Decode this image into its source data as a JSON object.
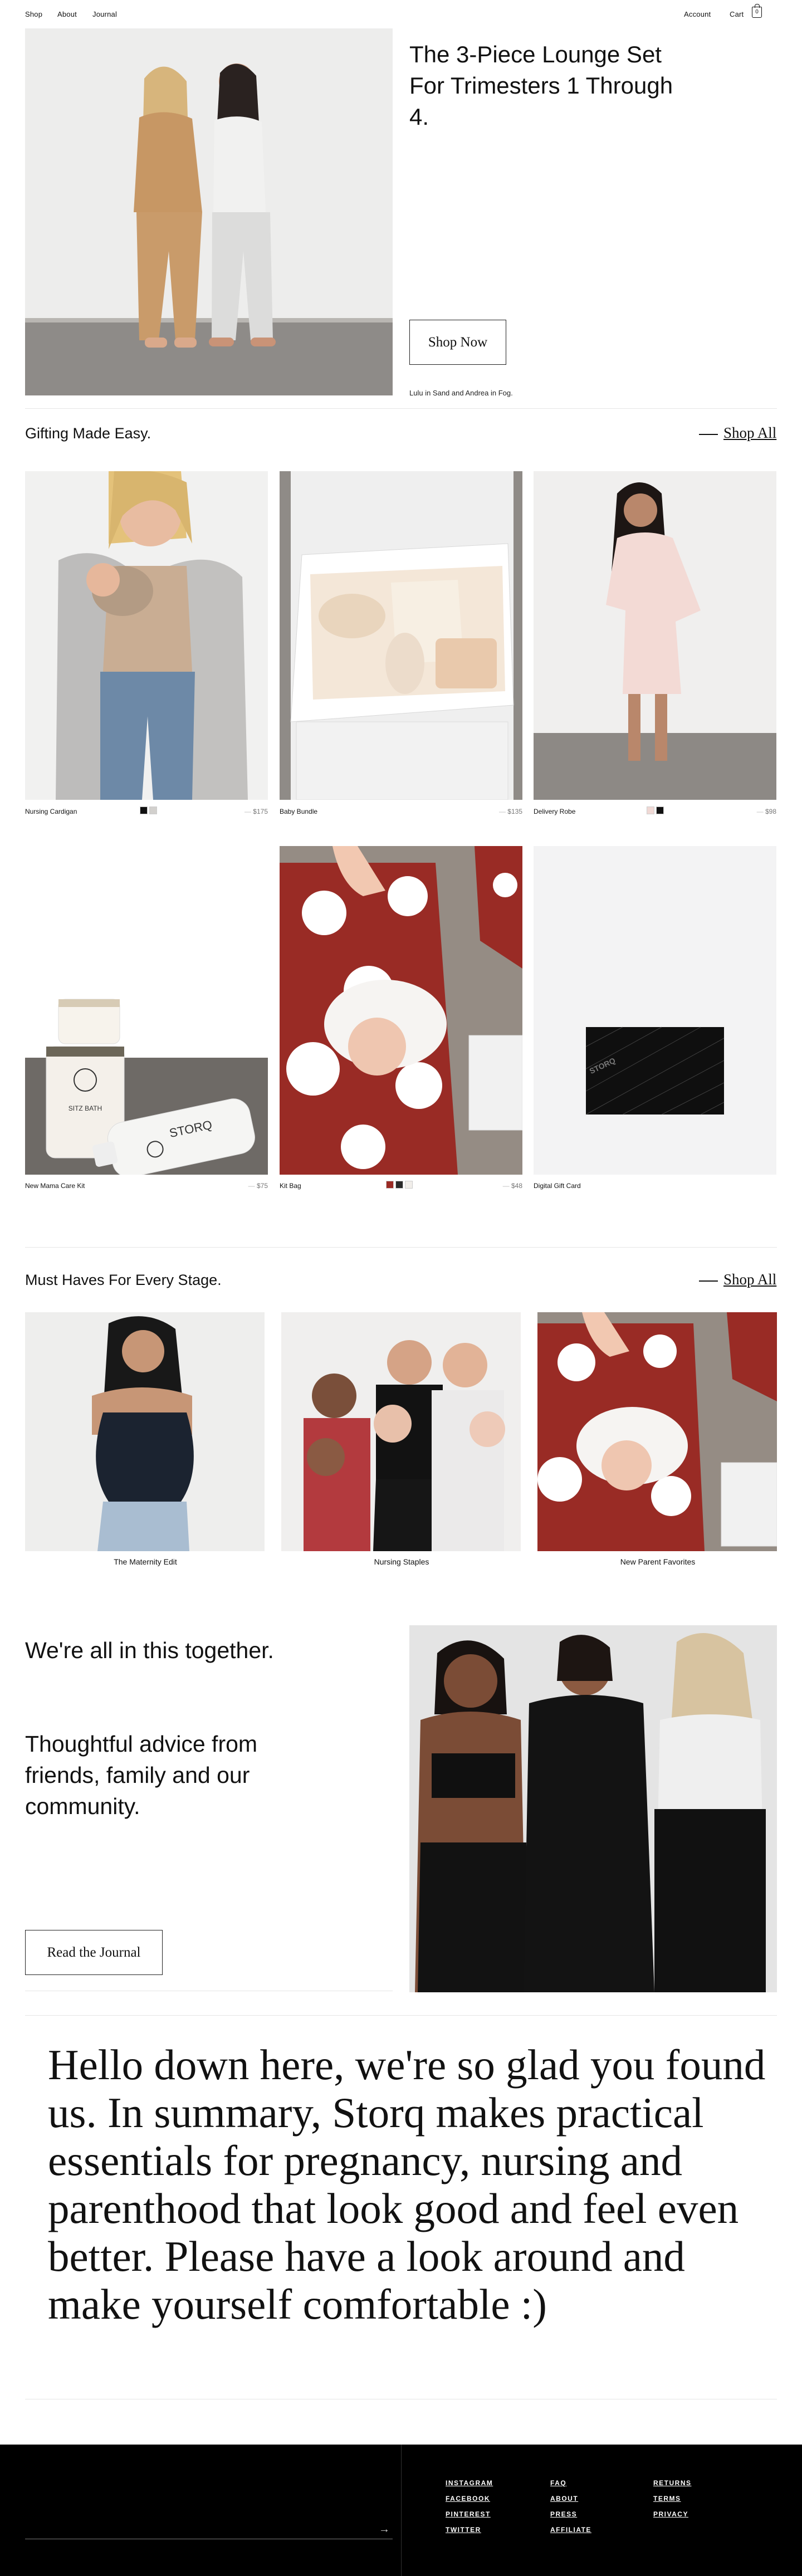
{
  "nav": {
    "shop": "Shop",
    "about": "About",
    "journal": "Journal",
    "account": "Account",
    "cart": "Cart",
    "cart_count": "0"
  },
  "hero": {
    "title": "The 3-Piece Lounge Set For Trimesters 1 Through 4.",
    "cta": "Shop Now",
    "caption": "Lulu in Sand and Andrea in Fog."
  },
  "gifting": {
    "title": "Gifting Made Easy.",
    "shop_all": "Shop All",
    "products": [
      {
        "name": "Nursing Cardigan",
        "price": "$175"
      },
      {
        "name": "Baby Bundle",
        "price": "$135"
      },
      {
        "name": "Delivery Robe",
        "price": "$98"
      },
      {
        "name": "New Mama Care Kit",
        "price": "$75"
      },
      {
        "name": "Kit Bag",
        "price": "$48"
      },
      {
        "name": "Digital Gift Card",
        "price": ""
      }
    ],
    "gift_card_word": "STORQ"
  },
  "stages": {
    "title": "Must Haves For Every Stage.",
    "shop_all": "Shop All",
    "categories": [
      {
        "label": "The Maternity Edit"
      },
      {
        "label": "Nursing Staples"
      },
      {
        "label": "New Parent Favorites"
      }
    ]
  },
  "journal": {
    "line1": "We're all in this together.",
    "line2": "Thoughtful advice from friends, family and our community.",
    "cta": "Read the Journal"
  },
  "summary": {
    "text": "Hello down here, we're so glad you found us. In summary, Storq makes practical essentials for pregnancy, nursing and parenthood that look good and feel even better. Please have a look around and make yourself comfortable :)"
  },
  "product_brand": {
    "jar_label": "STORQ",
    "bottle_label": "STORQ",
    "bath_label": "SITZ BATH"
  },
  "footer": {
    "social": [
      "INSTAGRAM",
      "FACEBOOK",
      "PINTEREST",
      "TWITTER"
    ],
    "info": [
      "FAQ",
      "ABOUT",
      "PRESS",
      "AFFILIATE"
    ],
    "policy": [
      "RETURNS",
      "TERMS",
      "PRIVACY"
    ]
  },
  "colors": {
    "skin": "#d7a98a",
    "sand": "#c9996a",
    "fog": "#e3e3e3",
    "denim": "#6c8bab",
    "kitbag_red": "#9a2a24",
    "black": "#0f0f0f"
  },
  "icons": [
    "bag-icon",
    "arrow-right-icon"
  ]
}
